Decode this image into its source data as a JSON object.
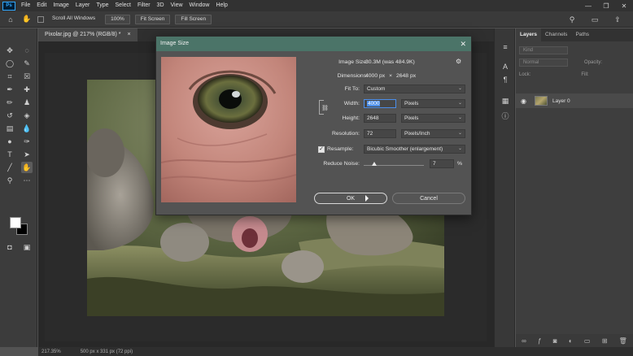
{
  "app": {
    "logo": "Ps"
  },
  "menu": [
    "File",
    "Edit",
    "Image",
    "Layer",
    "Type",
    "Select",
    "Filter",
    "3D",
    "View",
    "Window",
    "Help"
  ],
  "window_controls": {
    "minimize": "—",
    "maximize": "❐",
    "close": "✕"
  },
  "options": {
    "scroll_all": "Scroll All Windows",
    "zoom": "100%",
    "fit_screen": "Fit Screen",
    "fill_screen": "Fill Screen"
  },
  "document": {
    "tab_title": "Pixolar.jpg @ 217% (RGB/8) *",
    "tab_close": "×"
  },
  "status": {
    "zoom": "217.35%",
    "info": "500 px x 331 px (72 ppi)"
  },
  "layers_panel": {
    "tabs": [
      "Layers",
      "Channels",
      "Paths"
    ],
    "kind_placeholder": "Kind",
    "blend_mode": "Normal",
    "opacity_label": "Opacity:",
    "lock_label": "Lock:",
    "fill_label": "Fill:",
    "layer_name": "Layer 0"
  },
  "dialog": {
    "title": "Image Size",
    "close": "✕",
    "image_size_label": "Image Size:",
    "image_size_value": "30.3M (was 484.9K)",
    "dimensions_label": "Dimensions:",
    "dim_w": "4000 px",
    "dim_x": "×",
    "dim_h": "2648 px",
    "fit_to_label": "Fit To:",
    "fit_to_value": "Custom",
    "width_label": "Width:",
    "width_value": "4000",
    "width_unit": "Pixels",
    "height_label": "Height:",
    "height_value": "2648",
    "height_unit": "Pixels",
    "resolution_label": "Resolution:",
    "resolution_value": "72",
    "resolution_unit": "Pixels/Inch",
    "resample_label": "Resample:",
    "resample_value": "Bicubic Smoother (enlargement)",
    "reduce_noise_label": "Reduce Noise:",
    "reduce_noise_value": "7",
    "reduce_noise_unit": "%",
    "ok": "OK",
    "cancel": "Cancel"
  },
  "colors": {
    "dialog_title_bar": "#4b7468",
    "focus_blue": "#4b8eea",
    "ui_dark": "#323232"
  }
}
